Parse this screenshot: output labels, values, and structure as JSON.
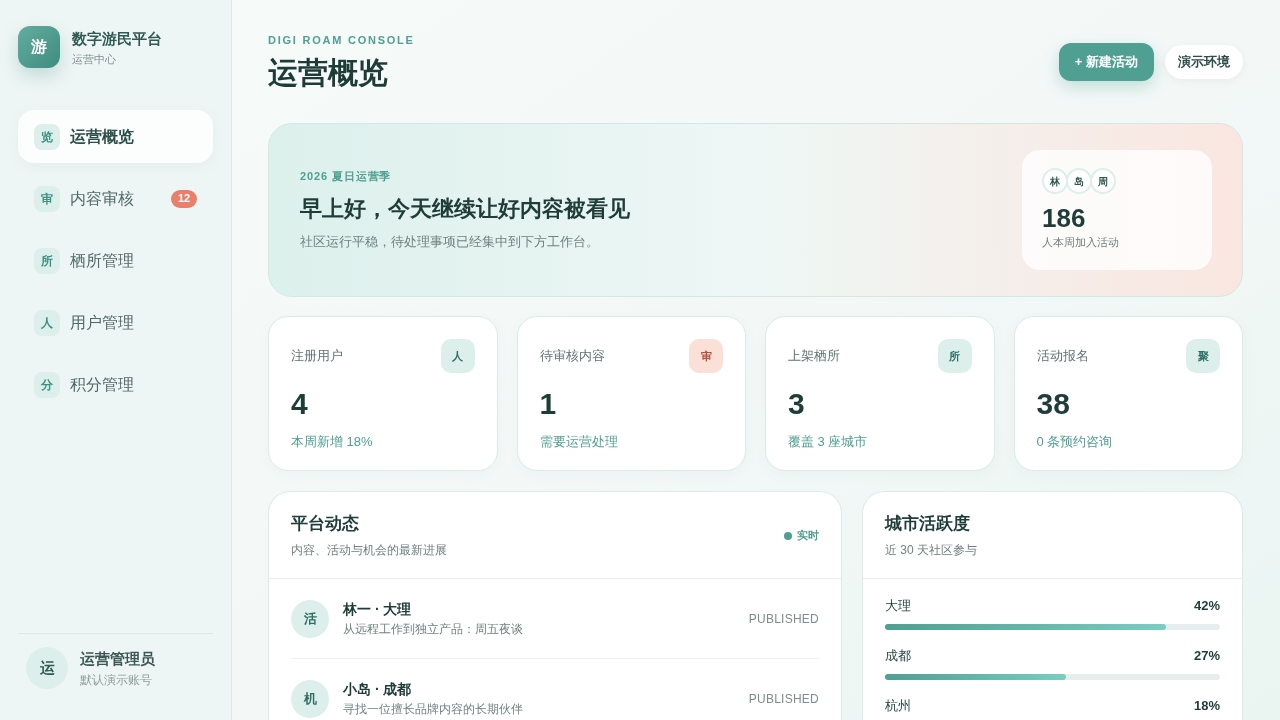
{
  "sidebar": {
    "logo": {
      "glyph": "游",
      "title": "数字游民平台",
      "subtitle": "运营中心"
    },
    "nav": [
      {
        "glyph": "览",
        "label": "运营概览",
        "selected": true
      },
      {
        "glyph": "审",
        "label": "内容审核",
        "selected": false,
        "badge": "12"
      },
      {
        "glyph": "所",
        "label": "栖所管理",
        "selected": false
      },
      {
        "glyph": "人",
        "label": "用户管理",
        "selected": false
      },
      {
        "glyph": "分",
        "label": "积分管理",
        "selected": false
      }
    ],
    "user": {
      "avatar": "运",
      "name": "运营管理员",
      "subtitle": "默认演示账号"
    }
  },
  "header": {
    "eyebrow": "DIGI ROAM CONSOLE",
    "title": "运营概览",
    "buttons": [
      {
        "kind": "primary",
        "label": "+ 新建活动"
      },
      {
        "kind": "secondary",
        "label": "演示环境"
      }
    ]
  },
  "hero": {
    "eyebrow": "2026 夏日运营季",
    "title": "早上好，今天继续让好内容被看见",
    "text": "社区运行平稳，待处理事项已经集中到下方工作台。",
    "summary": {
      "avatars": [
        "林",
        "岛",
        "周"
      ],
      "value": "186",
      "caption": "人本周加入活动"
    }
  },
  "stats": [
    {
      "label": "注册用户",
      "glyph": "人",
      "kind": "default",
      "value": "4",
      "note": "本周新增 18%"
    },
    {
      "label": "待审核内容",
      "glyph": "审",
      "kind": "alert",
      "value": "1",
      "note": "需要运营处理"
    },
    {
      "label": "上架栖所",
      "glyph": "所",
      "kind": "default",
      "value": "3",
      "note": "覆盖 3 座城市"
    },
    {
      "label": "活动报名",
      "glyph": "聚",
      "kind": "default",
      "value": "38",
      "note": "0 条预约咨询"
    }
  ],
  "feed": {
    "title": "平台动态",
    "subtitle": "内容、活动与机会的最新进展",
    "live": "实时",
    "items": [
      {
        "avatar": "活",
        "title": "林一 · 大理",
        "text": "从远程工作到独立产品：周五夜谈",
        "status": "PUBLISHED"
      },
      {
        "avatar": "机",
        "title": "小岛 · 成都",
        "text": "寻找一位擅长品牌内容的长期伙伴",
        "status": "PUBLISHED"
      }
    ]
  },
  "cities": {
    "title": "城市活跃度",
    "subtitle": "近 30 天社区参与",
    "rows": [
      {
        "name": "大理",
        "value": "42%",
        "level": 0.84
      },
      {
        "name": "成都",
        "value": "27%",
        "level": 0.54
      },
      {
        "name": "杭州",
        "value": "18%"
      }
    ]
  }
}
